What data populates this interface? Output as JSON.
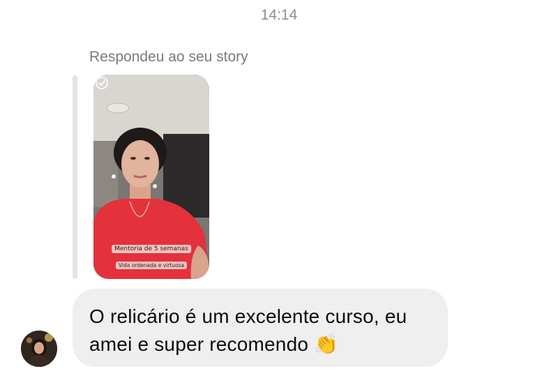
{
  "header": {
    "timestamp": "14:14"
  },
  "reply": {
    "label": "Respondeu ao seu story"
  },
  "story": {
    "badge_line_1": "Mentoria de 5 semanas",
    "badge_line_2": "Vida ordenada e virtuosa",
    "icons": {
      "status": "check-circle-icon"
    }
  },
  "message": {
    "text": "O relicário é um excelente curso, eu amei e super recomendo",
    "emoji": "👏",
    "bubble_color": "#efefef"
  },
  "sender": {
    "avatar_icon": "avatar"
  }
}
